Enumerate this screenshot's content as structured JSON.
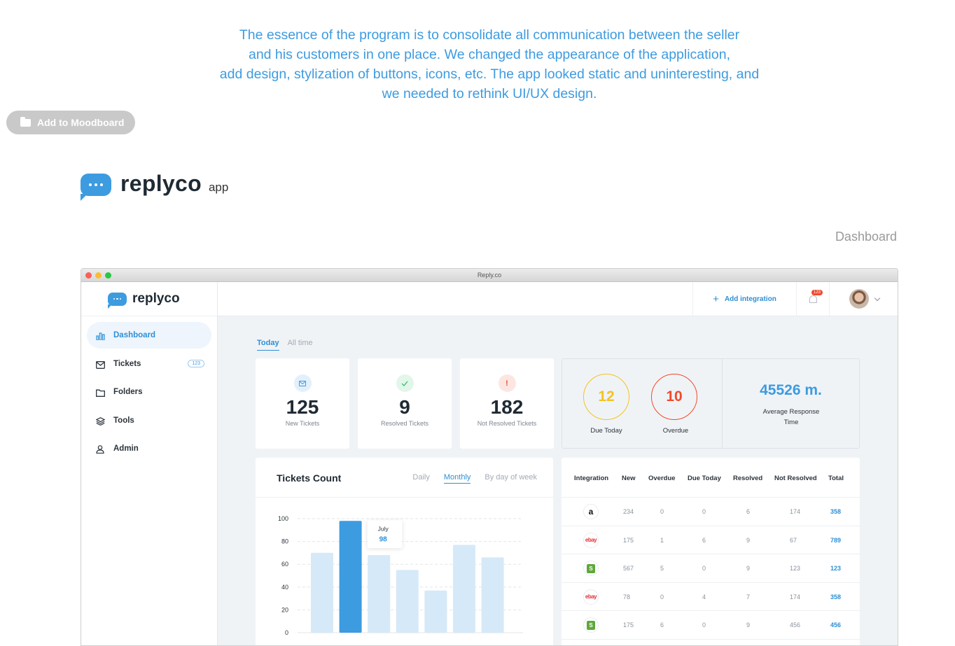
{
  "intro": {
    "lines": [
      "The essence of the program is to consolidate all communication between the seller",
      "and his customers in one place. We changed the appearance of the application,",
      "add design, stylization of buttons, icons, etc. The app looked static and uninteresting, and",
      "we needed to rethink UI/UX design."
    ]
  },
  "moodboard": {
    "label": "Add to Moodboard"
  },
  "brand": {
    "name": "replyco",
    "suffix": "app"
  },
  "section": {
    "label": "Dashboard"
  },
  "window": {
    "title": "Reply.co"
  },
  "app": {
    "logo": "replyco",
    "sidebar": {
      "items": [
        {
          "label": "Dashboard",
          "icon": "bar-chart-icon",
          "active": true
        },
        {
          "label": "Tickets",
          "icon": "mail-icon",
          "badge": "123"
        },
        {
          "label": "Folders",
          "icon": "folder-icon"
        },
        {
          "label": "Tools",
          "icon": "layers-icon"
        },
        {
          "label": "Admin",
          "icon": "user-icon"
        }
      ]
    },
    "topbar": {
      "add_integration": "Add integration",
      "notifications": "123"
    },
    "period_tabs": [
      "Today",
      "All time"
    ],
    "stats": [
      {
        "value": "125",
        "label": "New Tickets",
        "icon": "mail-icon",
        "color": "#3d9be0",
        "bg": "#e3f0fb"
      },
      {
        "value": "9",
        "label": "Resolved Tickets",
        "icon": "check-icon",
        "color": "#32b56b",
        "bg": "#e2f6ea"
      },
      {
        "value": "182",
        "label": "Not Resolved Tickets",
        "icon": "exclamation-icon",
        "color": "#f04a2c",
        "bg": "#fde6e2"
      }
    ],
    "due": {
      "value": "12",
      "label": "Due Today",
      "color": "#f2c321"
    },
    "overdue": {
      "value": "10",
      "label": "Overdue",
      "color": "#f04a2c"
    },
    "avg": {
      "value": "45526 m.",
      "label_line1": "Average Response",
      "label_line2": "Time"
    },
    "chart": {
      "title": "Tickets Count",
      "tabs": [
        "Daily",
        "Monthly",
        "By day of week"
      ],
      "tooltip": {
        "label": "July",
        "value": "98"
      }
    },
    "table": {
      "headers": [
        "Integration",
        "New",
        "Overdue",
        "Due Today",
        "Resolved",
        "Not Resolved",
        "Total"
      ],
      "rows": [
        {
          "logo": "amazon-icon",
          "glyph": "a",
          "new": "234",
          "overdue": "0",
          "due": "0",
          "resolved": "6",
          "not_resolved": "174",
          "total": "358"
        },
        {
          "logo": "ebay-icon",
          "glyph": "ebay",
          "new": "175",
          "overdue": "1",
          "due": "6",
          "resolved": "9",
          "not_resolved": "67",
          "total": "789"
        },
        {
          "logo": "shopify-icon",
          "glyph": "S",
          "new": "567",
          "overdue": "5",
          "due": "0",
          "resolved": "9",
          "not_resolved": "123",
          "total": "123"
        },
        {
          "logo": "ebay-icon",
          "glyph": "ebay",
          "new": "78",
          "overdue": "0",
          "due": "4",
          "resolved": "7",
          "not_resolved": "174",
          "total": "358"
        },
        {
          "logo": "shopify-icon",
          "glyph": "S",
          "new": "175",
          "overdue": "6",
          "due": "0",
          "resolved": "9",
          "not_resolved": "456",
          "total": "456"
        }
      ]
    }
  },
  "chart_data": {
    "type": "bar",
    "categories": [
      "",
      "July",
      "",
      "",
      "",
      "",
      ""
    ],
    "values": [
      70,
      98,
      68,
      55,
      37,
      77,
      66
    ],
    "highlight_index": 1,
    "yticks": [
      0,
      20,
      40,
      60,
      80,
      100
    ],
    "ylim": [
      0,
      100
    ],
    "colors": {
      "bar": "#d6e9f8",
      "highlight": "#3d9be0",
      "grid": "#e2e6ea"
    }
  }
}
